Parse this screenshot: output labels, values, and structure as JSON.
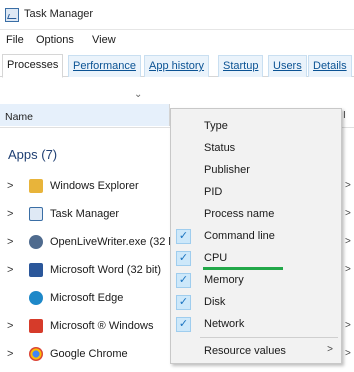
{
  "window": {
    "title": "Task Manager",
    "icon": "task-manager-icon"
  },
  "menubar": [
    "File",
    "Options",
    "View"
  ],
  "tabs": [
    {
      "label": "Processes",
      "active": true
    },
    {
      "label": "Performance",
      "active": false
    },
    {
      "label": "App history",
      "active": false
    },
    {
      "label": "Startup",
      "active": false
    },
    {
      "label": "Users",
      "active": false
    },
    {
      "label": "Details",
      "active": false
    }
  ],
  "table": {
    "collapse_glyph": "⌄",
    "column_name": "Name",
    "right_sliver_header": "I"
  },
  "group": {
    "label": "Apps (7)"
  },
  "processes": [
    {
      "name": "Windows Explorer",
      "expander": ">",
      "edge": ">",
      "icon": "folder-icon",
      "icon_color": "#e8b43a"
    },
    {
      "name": "Task Manager",
      "expander": ">",
      "edge": ">",
      "icon": "task-manager-icon",
      "icon_color": "#3a6ea5"
    },
    {
      "name": "OpenLiveWriter.exe (32 bit)",
      "expander": ">",
      "edge": ">",
      "icon": "openlivewriter-icon",
      "icon_color": "#4f6b8e"
    },
    {
      "name": "Microsoft Word (32 bit)",
      "expander": ">",
      "edge": ">",
      "icon": "word-icon",
      "icon_color": "#2b579a"
    },
    {
      "name": "Microsoft Edge",
      "expander": "",
      "edge": "",
      "icon": "edge-icon",
      "icon_color": "#1e88c8"
    },
    {
      "name": "Microsoft ® Windows",
      "expander": ">",
      "edge": ">",
      "icon": "windows-icon",
      "icon_color": "#d63b2a"
    },
    {
      "name": "Google Chrome",
      "expander": ">",
      "edge": ">",
      "icon": "chrome-icon",
      "icon_color": "#4285f4"
    }
  ],
  "context_menu": {
    "items": [
      {
        "label": "Type",
        "checked": false
      },
      {
        "label": "Status",
        "checked": false
      },
      {
        "label": "Publisher",
        "checked": false
      },
      {
        "label": "PID",
        "checked": false
      },
      {
        "label": "Process name",
        "checked": false
      },
      {
        "label": "Command line",
        "checked": true
      },
      {
        "label": "CPU",
        "checked": true
      },
      {
        "label": "Memory",
        "checked": true
      },
      {
        "label": "Disk",
        "checked": true
      },
      {
        "label": "Network",
        "checked": true
      }
    ],
    "check_glyph": "✓",
    "highlight_color": "#22a849",
    "submenu": {
      "label": "Resource values",
      "arrow": ">"
    }
  }
}
